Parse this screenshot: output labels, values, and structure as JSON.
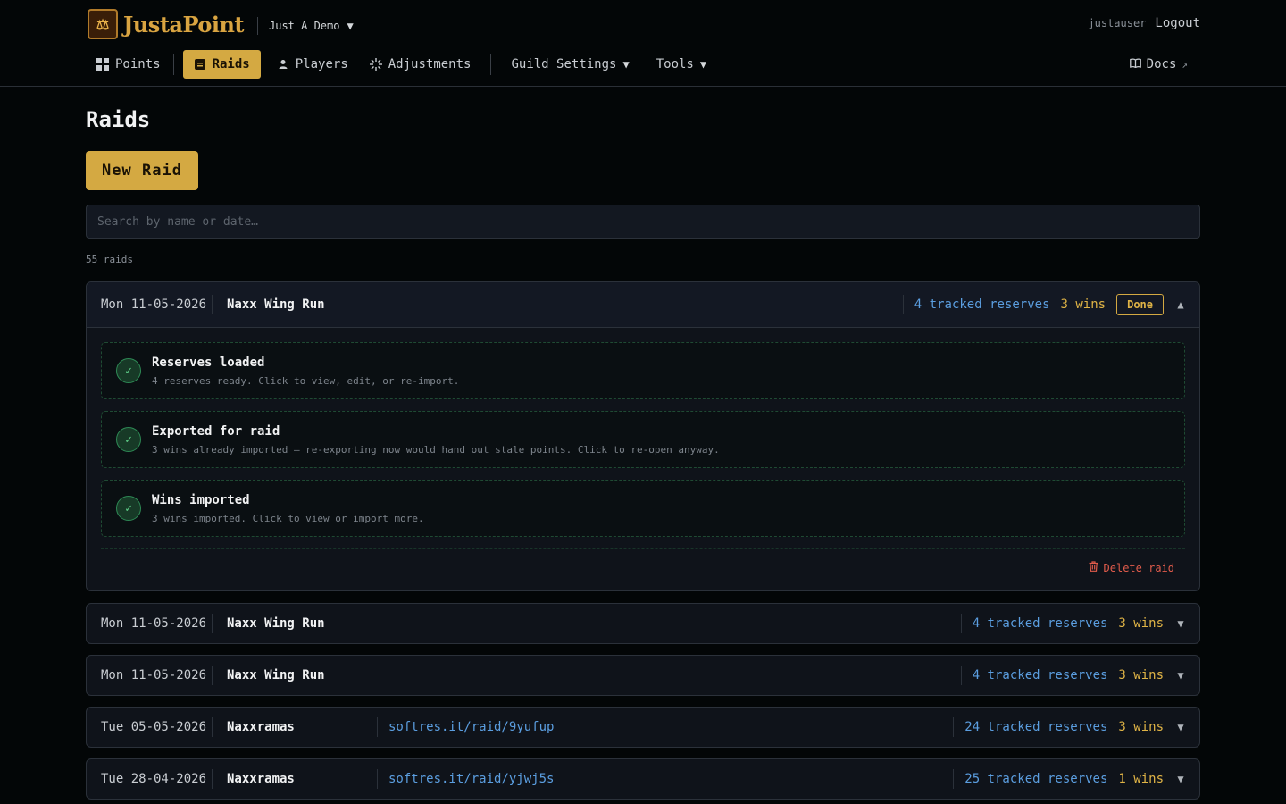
{
  "header": {
    "logo_glyph": "⚖",
    "brand": "JustaPoint",
    "guild": "Just A Demo",
    "username": "justauser",
    "logout": "Logout"
  },
  "nav": {
    "points": "Points",
    "raids": "Raids",
    "players": "Players",
    "adjustments": "Adjustments",
    "guild_settings": "Guild Settings",
    "tools": "Tools",
    "docs": "Docs"
  },
  "main": {
    "title": "Raids",
    "new_raid": "New Raid",
    "search_placeholder": "Search by name or date…",
    "count": "55 raids"
  },
  "raids": [
    {
      "date": "Mon 11-05-2026",
      "name": "Naxx Wing Run",
      "link": "",
      "tracked": "4 tracked reserves",
      "wins": "3 wins",
      "status": "Done",
      "expanded": true,
      "steps": [
        {
          "title": "Reserves loaded",
          "desc": "4 reserves ready. Click to view, edit, or re-import."
        },
        {
          "title": "Exported for raid",
          "desc": "3 wins already imported — re-exporting now would hand out stale points. Click to re-open anyway."
        },
        {
          "title": "Wins imported",
          "desc": "3 wins imported. Click to view or import more."
        }
      ],
      "delete": "Delete raid"
    },
    {
      "date": "Mon 11-05-2026",
      "name": "Naxx Wing Run",
      "link": "",
      "tracked": "4 tracked reserves",
      "wins": "3 wins"
    },
    {
      "date": "Mon 11-05-2026",
      "name": "Naxx Wing Run",
      "link": "",
      "tracked": "4 tracked reserves",
      "wins": "3 wins"
    },
    {
      "date": "Tue 05-05-2026",
      "name": "Naxxramas",
      "link": "softres.it/raid/9yufup",
      "tracked": "24 tracked reserves",
      "wins": "3 wins"
    },
    {
      "date": "Tue 28-04-2026",
      "name": "Naxxramas",
      "link": "softres.it/raid/yjwj5s",
      "tracked": "25 tracked reserves",
      "wins": "1 wins"
    }
  ],
  "colors": {
    "accent": "#d4a942",
    "link": "#5b9ee0",
    "success": "#5fd08a",
    "danger": "#e05b4b",
    "background": "#030607"
  }
}
